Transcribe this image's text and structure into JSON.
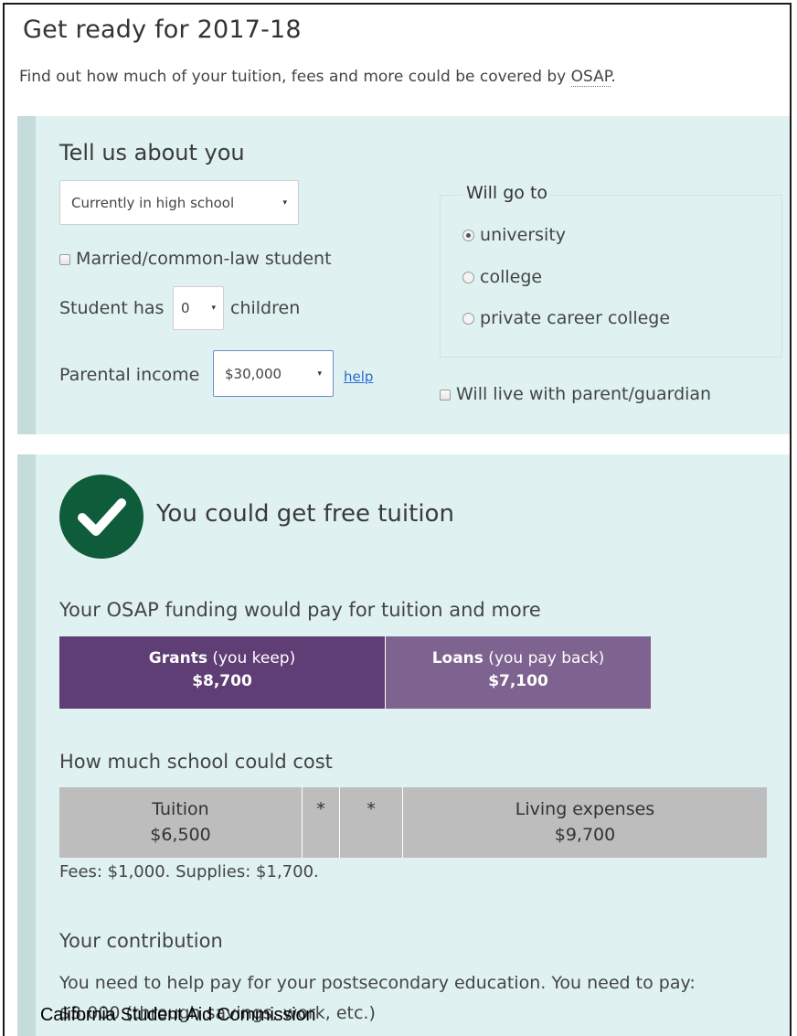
{
  "header": {
    "title": "Get ready for 2017-18",
    "subtitle_lead": "Find out how much of your tuition, fees and more could be covered by ",
    "subtitle_abbr": "OSAP",
    "subtitle_tail": "."
  },
  "about": {
    "heading": "Tell us about you",
    "status_select": {
      "value": "Currently in high school",
      "caret": "▾"
    },
    "married_checkbox": {
      "checked": false,
      "label": "Married/common-law student"
    },
    "children_prefix": "Student has",
    "children_select": {
      "value": "0",
      "caret": "▾"
    },
    "children_suffix": "children",
    "income_label": "Parental income",
    "income_select": {
      "value": "$30,000",
      "caret": "▾"
    },
    "help_link": "help",
    "will_go_to": {
      "legend": "Will go to",
      "options": [
        {
          "label": "university",
          "checked": true
        },
        {
          "label": "college",
          "checked": false
        },
        {
          "label": "private career college",
          "checked": false
        }
      ]
    },
    "live_with_parent": {
      "checked": false,
      "label": "Will live with parent/guardian"
    }
  },
  "result": {
    "check_icon": "check-circle-icon",
    "accent_color": "#0f5c3a",
    "heading": "You could get free tuition",
    "funding": {
      "heading": "Your OSAP funding would pay for tuition and more",
      "grants": {
        "label_bold": "Grants",
        "label_rest": " (you keep)",
        "value": "$8,700",
        "color": "#5f3d75"
      },
      "loans": {
        "label_bold": "Loans",
        "label_rest": " (you pay back)",
        "value": "$7,100",
        "color": "#7e6290"
      }
    },
    "cost": {
      "heading": "How much school could cost",
      "tuition": {
        "label": "Tuition",
        "value": "$6,500"
      },
      "fees_mark": "*",
      "supplies_mark": "*",
      "living": {
        "label": "Living expenses",
        "value": "$9,700"
      },
      "note": "Fees: $1,000. Supplies: $1,700."
    },
    "contribution": {
      "heading": "Your contribution",
      "text": "You need to help pay for your postsecondary education. You need to pay:",
      "amount_text": "$3,000 (through savings, work, etc.)"
    }
  },
  "footer": {
    "credit": "California Student Aid Commission"
  }
}
